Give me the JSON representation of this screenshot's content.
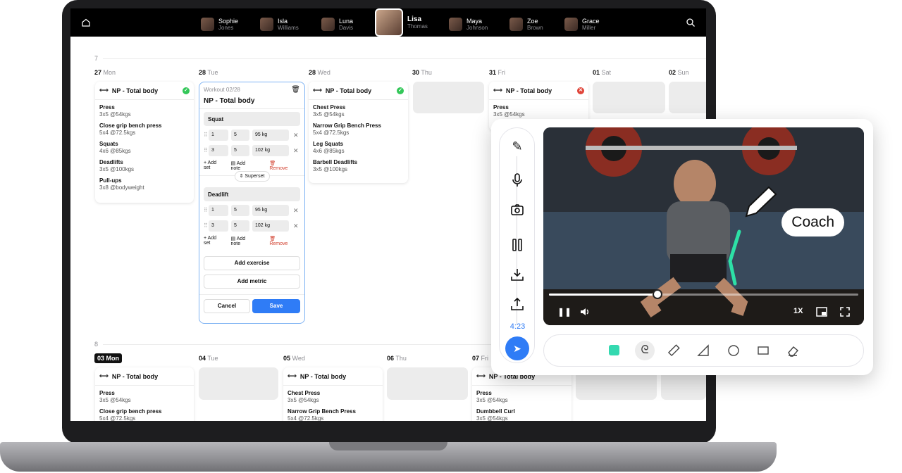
{
  "athletes": [
    {
      "first": "Sophie",
      "last": "Jones",
      "selected": false
    },
    {
      "first": "Isla",
      "last": "Williams",
      "selected": false
    },
    {
      "first": "Luna",
      "last": "Davis",
      "selected": false
    },
    {
      "first": "Lisa",
      "last": "Thomas",
      "selected": true
    },
    {
      "first": "Maya",
      "last": "Johnson",
      "selected": false
    },
    {
      "first": "Zoe",
      "last": "Brown",
      "selected": false
    },
    {
      "first": "Grace",
      "last": "Miller",
      "selected": false
    }
  ],
  "weeks": [
    {
      "number": "7",
      "days": [
        {
          "num": "27",
          "name": "Mon"
        },
        {
          "num": "28",
          "name": "Tue"
        },
        {
          "num": "28",
          "name": "Wed"
        },
        {
          "num": "30",
          "name": "Thu"
        },
        {
          "num": "31",
          "name": "Fri"
        },
        {
          "num": "01",
          "name": "Sat"
        },
        {
          "num": "02",
          "name": "Sun"
        }
      ]
    },
    {
      "number": "8",
      "days": [
        {
          "num": "03",
          "name": "Mon",
          "today": true
        },
        {
          "num": "04",
          "name": "Tue"
        },
        {
          "num": "05",
          "name": "Wed"
        },
        {
          "num": "06",
          "name": "Thu"
        },
        {
          "num": "07",
          "name": "Fri"
        }
      ]
    }
  ],
  "workouts": {
    "w7_mon": {
      "title": "NP - Total body",
      "status": "done",
      "exercises": [
        {
          "name": "Press",
          "sets": "3x5 @54kgs"
        },
        {
          "name": "Close grip bench press",
          "sets": "5x4 @72.5kgs"
        },
        {
          "name": "Squats",
          "sets": "4x6 @85kgs"
        },
        {
          "name": "Deadlifts",
          "sets": "3x5 @100kgs"
        },
        {
          "name": "Pull-ups",
          "sets": "3x8 @bodyweight"
        }
      ]
    },
    "w7_wed": {
      "title": "NP - Total body",
      "status": "done",
      "exercises": [
        {
          "name": "Chest Press",
          "sets": "3x5 @54kgs"
        },
        {
          "name": "Narrow Grip Bench Press",
          "sets": "5x4 @72.5kgs"
        },
        {
          "name": "Leg Squats",
          "sets": "4x6 @85kgs"
        },
        {
          "name": "Barbell Deadlifts",
          "sets": "3x5 @100kgs"
        }
      ]
    },
    "w7_fri": {
      "title": "NP - Total body",
      "status": "missed",
      "exercises": [
        {
          "name": "Press",
          "sets": "3x5 @54kgs"
        }
      ]
    },
    "w8_mon": {
      "title": "NP - Total body",
      "exercises": [
        {
          "name": "Press",
          "sets": "3x5 @54kgs"
        },
        {
          "name": "Close grip bench press",
          "sets": "5x4 @72.5kgs"
        }
      ]
    },
    "w8_wed": {
      "title": "NP - Total body",
      "exercises": [
        {
          "name": "Chest Press",
          "sets": "3x5 @54kgs"
        },
        {
          "name": "Narrow Grip Bench Press",
          "sets": "5x4 @72.5kgs"
        }
      ]
    },
    "w8_fri": {
      "title": "NP - Total body",
      "exercises": [
        {
          "name": "Press",
          "sets": "3x5 @54kgs"
        },
        {
          "name": "Dumbbell Curl",
          "sets": "3x5 @54kgs"
        }
      ]
    }
  },
  "editor": {
    "label": "Workout 02/28",
    "title": "NP - Total body",
    "blocks": [
      {
        "name": "Squat",
        "sets": [
          {
            "set": "1",
            "reps": "5",
            "weight": "95 kg"
          },
          {
            "set": "3",
            "reps": "5",
            "weight": "102 kg"
          }
        ]
      },
      {
        "name": "Deadlift",
        "sets": [
          {
            "set": "1",
            "reps": "5",
            "weight": "95 kg"
          },
          {
            "set": "3",
            "reps": "5",
            "weight": "102 kg"
          }
        ]
      }
    ],
    "add_set": "+ Add set",
    "add_note": "Add note",
    "remove": "Remove",
    "superset": "Superset",
    "add_exercise": "Add exercise",
    "add_metric": "Add metric",
    "cancel": "Cancel",
    "save": "Save"
  },
  "video_panel": {
    "timer": "4:23",
    "overlay_label": "Coach",
    "progress": 0.35,
    "speed": "1X",
    "tools": [
      "color-swatch",
      "freehand",
      "ruler",
      "angle",
      "circle",
      "rectangle",
      "eraser"
    ],
    "swatch_color": "#34d9b0"
  },
  "colors": {
    "accent": "#2f7cf6",
    "done": "#34c759",
    "missed": "#e0453a"
  }
}
